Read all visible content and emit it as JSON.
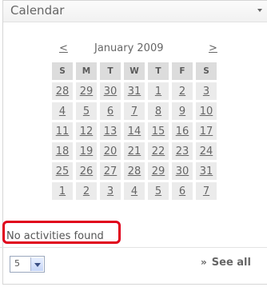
{
  "widget": {
    "title": "Calendar",
    "collapse_icon": "chevron-down-icon"
  },
  "calendar": {
    "prev_label": "<",
    "next_label": ">",
    "month_label": "January 2009",
    "weekdays": [
      "S",
      "M",
      "T",
      "W",
      "T",
      "F",
      "S"
    ],
    "weeks": [
      [
        "28",
        "29",
        "30",
        "31",
        "1",
        "2",
        "3"
      ],
      [
        "4",
        "5",
        "6",
        "7",
        "8",
        "9",
        "10"
      ],
      [
        "11",
        "12",
        "13",
        "14",
        "15",
        "16",
        "17"
      ],
      [
        "18",
        "19",
        "20",
        "21",
        "22",
        "23",
        "24"
      ],
      [
        "25",
        "26",
        "27",
        "28",
        "29",
        "30",
        "31"
      ],
      [
        "1",
        "2",
        "3",
        "4",
        "5",
        "6",
        "7"
      ]
    ]
  },
  "status": {
    "text": "No activities found",
    "highlight_color": "#e0001b"
  },
  "footer": {
    "count_value": "5",
    "see_all_prefix": "»",
    "see_all_label": "See all"
  }
}
